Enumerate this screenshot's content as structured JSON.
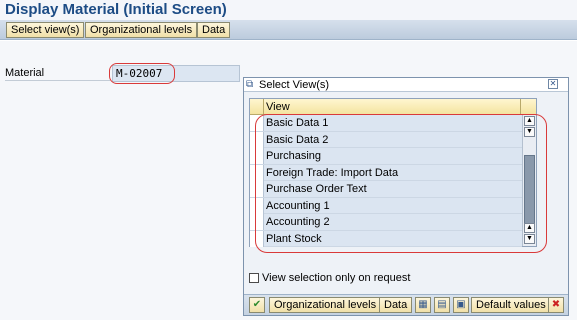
{
  "window": {
    "title": "Display Material (Initial Screen)"
  },
  "toolbar": {
    "select_views": "Select view(s)",
    "org_levels": "Organizational levels",
    "data": "Data"
  },
  "material": {
    "label": "Material",
    "value": "M-02007"
  },
  "popup": {
    "title": "Select View(s)",
    "close_glyph": "✕",
    "title_icon_glyph": "⧉",
    "column_header": "View",
    "views": [
      "Basic Data 1",
      "Basic Data 2",
      "Purchasing",
      "Foreign Trade: Import Data",
      "Purchase Order Text",
      "Accounting 1",
      "Accounting 2",
      "Plant Stock"
    ],
    "view_selection_label": "View selection only on request",
    "footer": {
      "confirm_glyph": "✔",
      "org_levels": "Organizational levels",
      "data": "Data",
      "select_all_glyph": "▦",
      "deselect_all_glyph": "▤",
      "save_glyph": "▣",
      "default_values": "Default values",
      "cancel_glyph": "✖"
    },
    "scroll": {
      "up_glyph": "▲",
      "down_glyph": "▼"
    }
  },
  "colors": {
    "title": "#1d4c85",
    "highlight_oval": "#d93a3a",
    "confirm": "#2e8b2e",
    "cancel": "#cc2222"
  }
}
